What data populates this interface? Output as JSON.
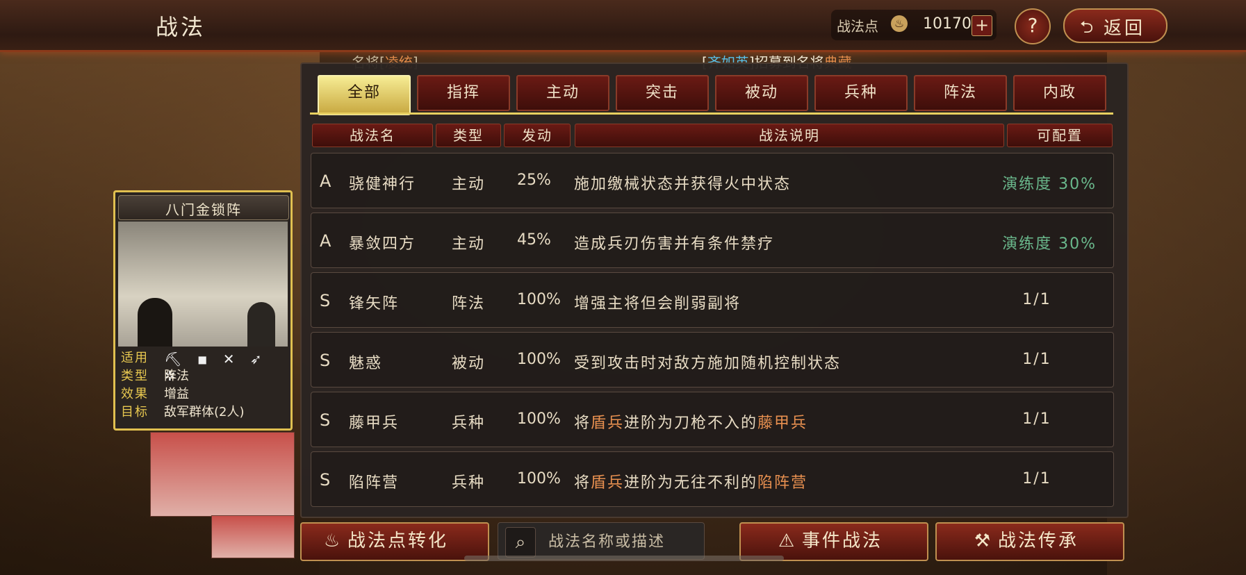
{
  "header": {
    "title": "战法",
    "points_label": "战法点",
    "points_icon": "flame-icon",
    "points_value": "10170",
    "plus_label": "+",
    "help_label": "?",
    "back_label": "返回"
  },
  "ticker": {
    "left_prefix": "名将[",
    "left_name": "凌统",
    "left_suffix": "]",
    "right_open": "[",
    "right_name": "齐如英",
    "right_close": "]",
    "right_text": "招募到名将",
    "right_general": "典藏"
  },
  "tabs": [
    {
      "label": "全部",
      "active": true
    },
    {
      "label": "指挥"
    },
    {
      "label": "主动"
    },
    {
      "label": "突击"
    },
    {
      "label": "被动"
    },
    {
      "label": "兵种"
    },
    {
      "label": "阵法"
    },
    {
      "label": "内政"
    }
  ],
  "columns": {
    "name": "战法名",
    "type": "类型",
    "rate": "发动",
    "desc": "战法说明",
    "config": "可配置"
  },
  "rows": [
    {
      "grade": "A",
      "name": "骁健神行",
      "type": "主动",
      "rate": "25%",
      "desc": "施加缴械状态并获得火中状态",
      "config": "演练度 30%"
    },
    {
      "grade": "A",
      "name": "暴敛四方",
      "type": "主动",
      "rate": "45%",
      "desc": "造成兵刃伤害并有条件禁疗",
      "config": "演练度 30%"
    },
    {
      "grade": "S",
      "name": "锋矢阵",
      "type": "阵法",
      "rate": "100%",
      "desc": "增强主将但会削弱副将",
      "config": "1/1"
    },
    {
      "grade": "S",
      "name": "魅惑",
      "type": "被动",
      "rate": "100%",
      "desc": "受到攻击时对敌方施加随机控制状态",
      "config": "1/1"
    },
    {
      "grade": "S",
      "name": "藤甲兵",
      "type": "兵种",
      "rate": "100%",
      "desc_a": "将",
      "desc_b": "盾兵",
      "desc_c": "进阶为刀枪不入的",
      "desc_d": "藤甲兵",
      "config": "1/1"
    },
    {
      "grade": "S",
      "name": "陷阵营",
      "type": "兵种",
      "rate": "100%",
      "desc_a": "将",
      "desc_b": "盾兵",
      "desc_c": "进阶为无往不利的",
      "desc_d": "陷阵营",
      "config": "1/1"
    }
  ],
  "card": {
    "title": "八门金锁阵",
    "apply_label": "适用",
    "troop_icons": "⛏ ◾ ✕ ➶ ✲",
    "type_label": "类型",
    "type_value": "阵法",
    "effect_label": "效果",
    "effect_value": "增益",
    "target_label": "目标",
    "target_value": "敌军群体(2人)"
  },
  "bottom": {
    "convert_label": "战法点转化",
    "search_placeholder": "战法名称或描述",
    "event_label": "事件战法",
    "inherit_label": "战法传承"
  },
  "colors": {
    "accent_gold": "#e8d060",
    "tab_red": "#6a1a14",
    "highlight_orange": "#e89050",
    "config_green": "#6ab88c"
  }
}
